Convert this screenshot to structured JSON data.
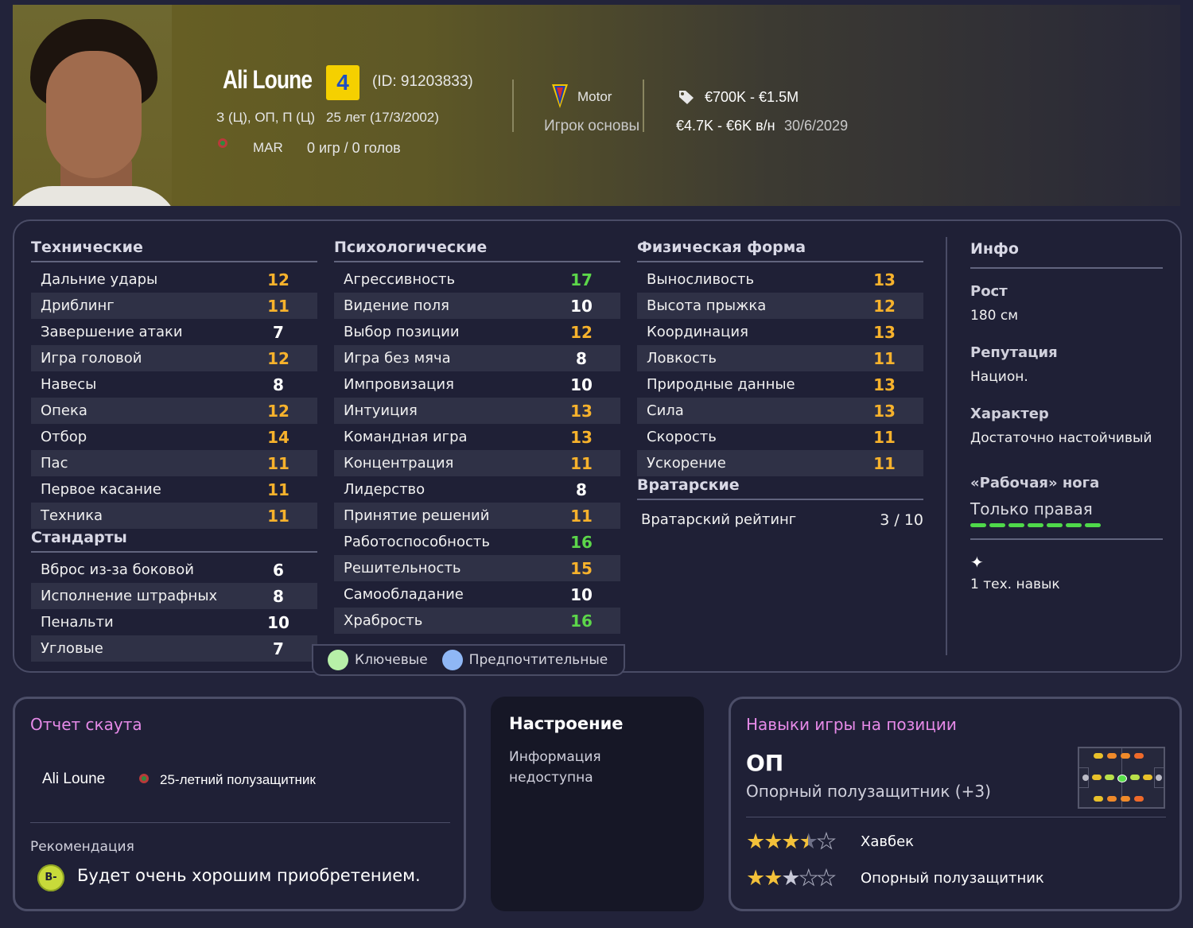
{
  "header": {
    "name": "Ali Loune",
    "ability": "4",
    "id_text": "(ID: 91203833)",
    "positions": "З (Ц), ОП, П (Ц)",
    "age": "25 лет (17/3/2002)",
    "nation": "MAR",
    "caps": "0 игр / 0 голов",
    "club": "Motor",
    "squad_role": "Игрок основы",
    "value": "€700K - €1.5M",
    "wage": "€4.7K - €6K  в/н",
    "contract_end": "30/6/2029"
  },
  "technical": {
    "title": "Технические",
    "rows": [
      {
        "label": "Дальние удары",
        "value": "12",
        "tone": "orange"
      },
      {
        "label": "Дриблинг",
        "value": "11",
        "tone": "orange"
      },
      {
        "label": "Завершение атаки",
        "value": "7",
        "tone": "white"
      },
      {
        "label": "Игра головой",
        "value": "12",
        "tone": "orange"
      },
      {
        "label": "Навесы",
        "value": "8",
        "tone": "white"
      },
      {
        "label": "Опека",
        "value": "12",
        "tone": "orange"
      },
      {
        "label": "Отбор",
        "value": "14",
        "tone": "orange"
      },
      {
        "label": "Пас",
        "value": "11",
        "tone": "orange"
      },
      {
        "label": "Первое касание",
        "value": "11",
        "tone": "orange"
      },
      {
        "label": "Техника",
        "value": "11",
        "tone": "orange"
      }
    ]
  },
  "set_pieces": {
    "title": "Стандарты",
    "rows": [
      {
        "label": "Вброс из-за боковой",
        "value": "6",
        "tone": "white"
      },
      {
        "label": "Исполнение штрафных",
        "value": "8",
        "tone": "white"
      },
      {
        "label": "Пенальти",
        "value": "10",
        "tone": "white"
      },
      {
        "label": "Угловые",
        "value": "7",
        "tone": "white"
      }
    ]
  },
  "mental": {
    "title": "Психологические",
    "rows": [
      {
        "label": "Агрессивность",
        "value": "17",
        "tone": "green"
      },
      {
        "label": "Видение поля",
        "value": "10",
        "tone": "white"
      },
      {
        "label": "Выбор позиции",
        "value": "12",
        "tone": "orange"
      },
      {
        "label": "Игра без мяча",
        "value": "8",
        "tone": "white"
      },
      {
        "label": "Импровизация",
        "value": "10",
        "tone": "white"
      },
      {
        "label": "Интуиция",
        "value": "13",
        "tone": "orange"
      },
      {
        "label": "Командная игра",
        "value": "13",
        "tone": "orange"
      },
      {
        "label": "Концентрация",
        "value": "11",
        "tone": "orange"
      },
      {
        "label": "Лидерство",
        "value": "8",
        "tone": "white"
      },
      {
        "label": "Принятие решений",
        "value": "11",
        "tone": "orange"
      },
      {
        "label": "Работоспособность",
        "value": "16",
        "tone": "green"
      },
      {
        "label": "Решительность",
        "value": "15",
        "tone": "orange"
      },
      {
        "label": "Самообладание",
        "value": "10",
        "tone": "white"
      },
      {
        "label": "Храбрость",
        "value": "16",
        "tone": "green"
      }
    ]
  },
  "physical": {
    "title": "Физическая форма",
    "rows": [
      {
        "label": "Выносливость",
        "value": "13",
        "tone": "orange"
      },
      {
        "label": "Высота прыжка",
        "value": "12",
        "tone": "orange"
      },
      {
        "label": "Координация",
        "value": "13",
        "tone": "orange"
      },
      {
        "label": "Ловкость",
        "value": "11",
        "tone": "orange"
      },
      {
        "label": "Природные данные",
        "value": "13",
        "tone": "orange"
      },
      {
        "label": "Сила",
        "value": "13",
        "tone": "orange"
      },
      {
        "label": "Скорость",
        "value": "11",
        "tone": "orange"
      },
      {
        "label": "Ускорение",
        "value": "11",
        "tone": "orange"
      }
    ]
  },
  "goalkeeping": {
    "title": "Вратарские",
    "label": "Вратарский рейтинг",
    "value": "3 / 10"
  },
  "legend": {
    "key": "Ключевые",
    "preferred": "Предпочтительные",
    "key_color": "#b7f0a8",
    "preferred_color": "#8fb7f5"
  },
  "info": {
    "title": "Инфо",
    "height_label": "Рост",
    "height": "180 см",
    "reputation_label": "Репутация",
    "reputation": "Национ.",
    "personality_label": "Характер",
    "personality": "Достаточно настойчивый",
    "foot_label": "«Рабочая» нога",
    "foot": "Только правая",
    "traits": "1 тех. навык"
  },
  "scout": {
    "title": "Отчет скаута",
    "name": "Ali Loune",
    "description": "25-летний полузащитник",
    "recommendation_label": "Рекомендация",
    "grade": "B-",
    "recommendation": "Будет очень хорошим приобретением."
  },
  "mood": {
    "title": "Настроение",
    "text_line1": "Информация",
    "text_line2": "недоступна"
  },
  "position_skills": {
    "title": "Навыки игры на позиции",
    "code": "ОП",
    "name": "Опорный полузащитник (+3)",
    "roles": [
      {
        "name": "Хавбек",
        "stars": 3.5
      },
      {
        "name": "Опорный полузащитник",
        "stars": 3
      }
    ]
  }
}
